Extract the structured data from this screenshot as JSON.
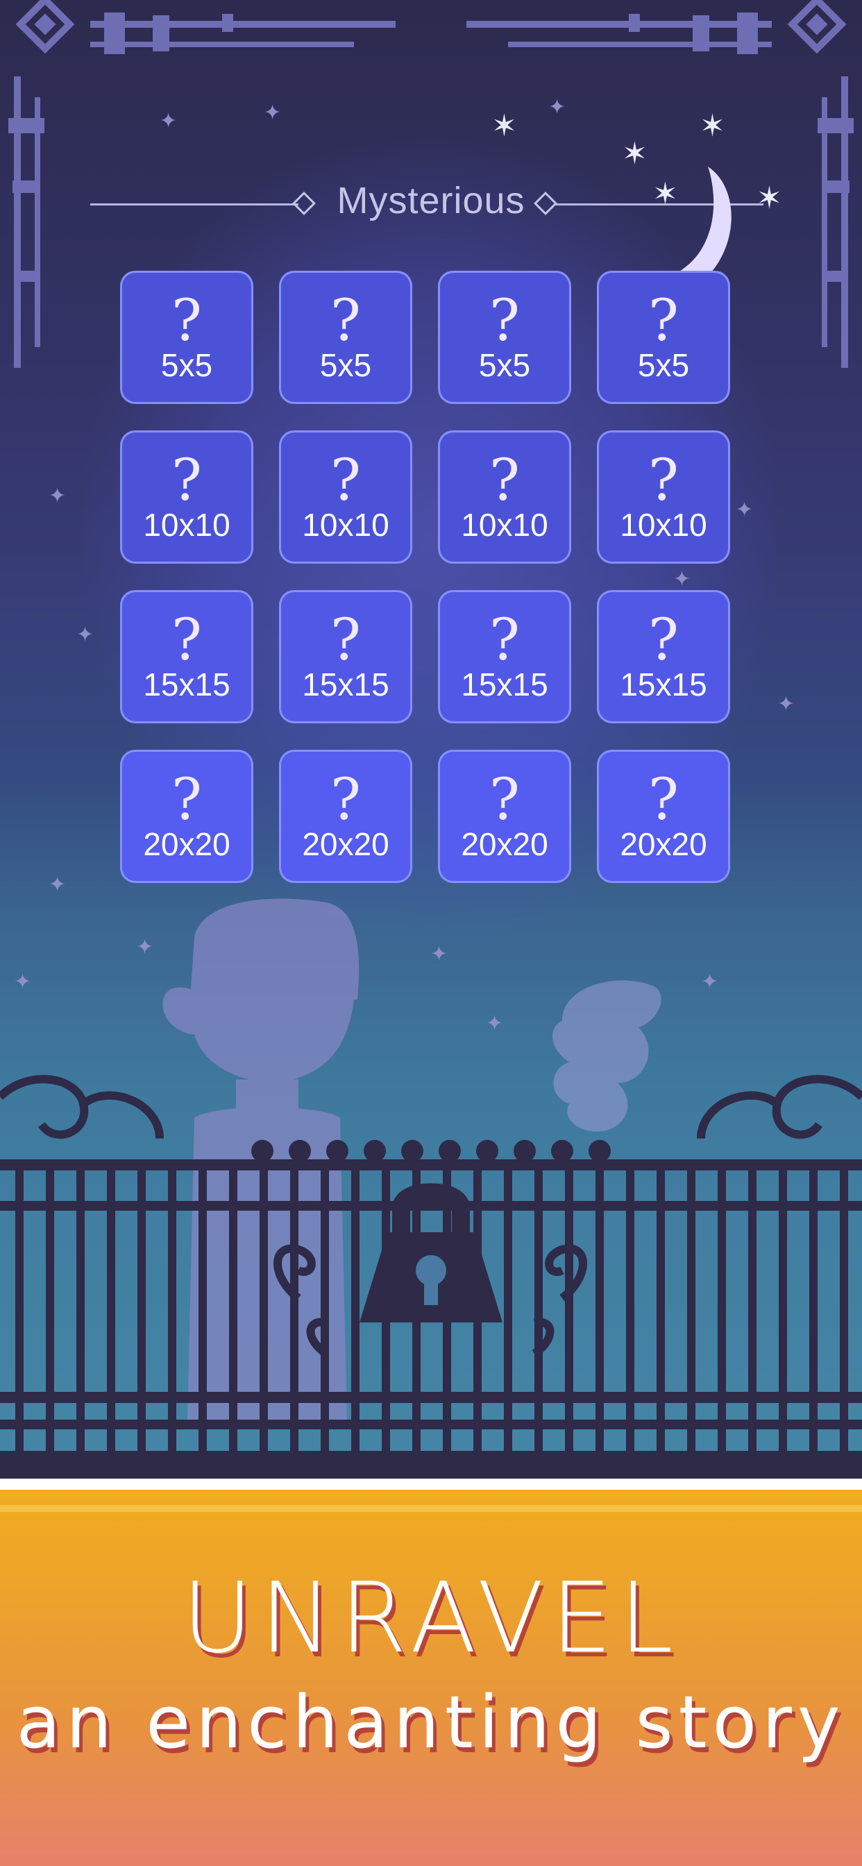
{
  "level_select": {
    "title": "Mysterious",
    "tiles": [
      {
        "symbol": "?",
        "size": "5x5"
      },
      {
        "symbol": "?",
        "size": "5x5"
      },
      {
        "symbol": "?",
        "size": "5x5"
      },
      {
        "symbol": "?",
        "size": "5x5"
      },
      {
        "symbol": "?",
        "size": "10x10"
      },
      {
        "symbol": "?",
        "size": "10x10"
      },
      {
        "symbol": "?",
        "size": "10x10"
      },
      {
        "symbol": "?",
        "size": "10x10"
      },
      {
        "symbol": "?",
        "size": "15x15"
      },
      {
        "symbol": "?",
        "size": "15x15"
      },
      {
        "symbol": "?",
        "size": "15x15"
      },
      {
        "symbol": "?",
        "size": "15x15"
      },
      {
        "symbol": "?",
        "size": "20x20"
      },
      {
        "symbol": "?",
        "size": "20x20"
      },
      {
        "symbol": "?",
        "size": "20x20"
      },
      {
        "symbol": "?",
        "size": "20x20"
      }
    ],
    "tile_colors": [
      "#4c52d8",
      "#4c52d8",
      "#5258e6",
      "#555cf0"
    ]
  },
  "scene": {
    "icons": [
      "moon-icon",
      "sparkle-star-icon",
      "lock-icon",
      "boy-silhouette",
      "ghost-silhouette",
      "iron-fence"
    ],
    "colors": {
      "sky_top": "#2c2a4e",
      "sky_bottom": "#4586a6",
      "fence": "#2e2a48",
      "ornament": "#6f6db4"
    }
  },
  "banner": {
    "headline": "UNRAVEL",
    "subheadline": "an enchanting story",
    "colors": {
      "top": "#f1ad1f",
      "bottom": "#e7816a",
      "text": "#ffffff",
      "shadow": "#b6433a"
    }
  }
}
